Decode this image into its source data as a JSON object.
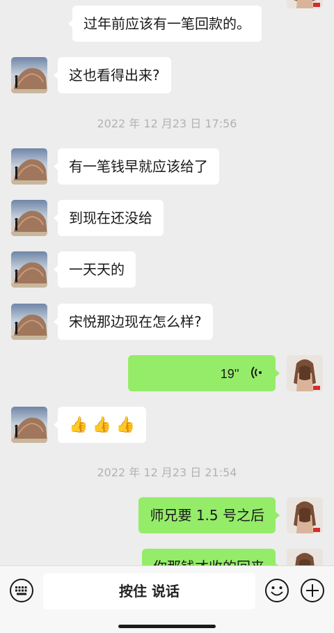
{
  "messages": [
    {
      "side": "in",
      "text": "过年前应该有一笔回款的。"
    },
    {
      "side": "in",
      "text": "这也看得出来?"
    },
    {
      "side": "in",
      "text": "有一笔钱早就应该给了"
    },
    {
      "side": "in",
      "text": "到现在还没给"
    },
    {
      "side": "in",
      "text": "一天天的"
    },
    {
      "side": "in",
      "text": "宋悦那边现在怎么样?"
    },
    {
      "side": "out",
      "type": "voice",
      "duration": "19''"
    },
    {
      "side": "in",
      "type": "emoji",
      "emoji": [
        "👍",
        "👍",
        "👍"
      ]
    },
    {
      "side": "out",
      "text": "师兄要 1.5 号之后"
    },
    {
      "side": "out",
      "text": "你那钱才收的回来"
    }
  ],
  "timestamps": [
    "2022 年 12 月23 日 17:56",
    "2022 年 12 月23 日 21:54"
  ],
  "bottombar": {
    "hold_to_talk": "按住 说话",
    "keyboard_icon": "keyboard-icon",
    "emoji_icon": "smiley-icon",
    "plus_icon": "plus-icon"
  },
  "colors": {
    "background": "#ededed",
    "incoming_bubble": "#ffffff",
    "outgoing_bubble": "#95ec69",
    "timestamp": "#b2b2b2"
  }
}
